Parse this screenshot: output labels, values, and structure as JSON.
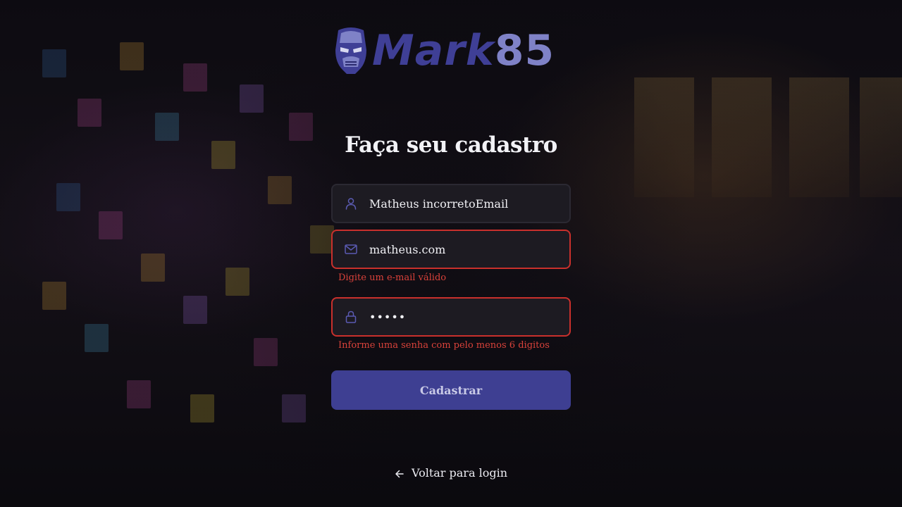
{
  "brand": {
    "logo_word": "Mark",
    "logo_number": "85",
    "logo_icon": "ironman-mask-icon",
    "primary_color": "#3f3f96",
    "accent_color": "#7f82c7"
  },
  "page": {
    "title": "Faça seu cadastro"
  },
  "form": {
    "name": {
      "icon": "user-icon",
      "value": "Matheus incorretoEmail"
    },
    "email": {
      "icon": "mail-icon",
      "value": "matheus.com",
      "error": "Digite um e-mail válido"
    },
    "password": {
      "icon": "lock-icon",
      "value": "•••••",
      "error": "Informe uma senha com pelo menos 6 digitos"
    },
    "submit_label": "Cadastrar",
    "error_color": "#c9302c",
    "button_color": "#3e3f92"
  },
  "footer": {
    "back_icon": "arrow-left-icon",
    "back_label": "Voltar para login"
  }
}
